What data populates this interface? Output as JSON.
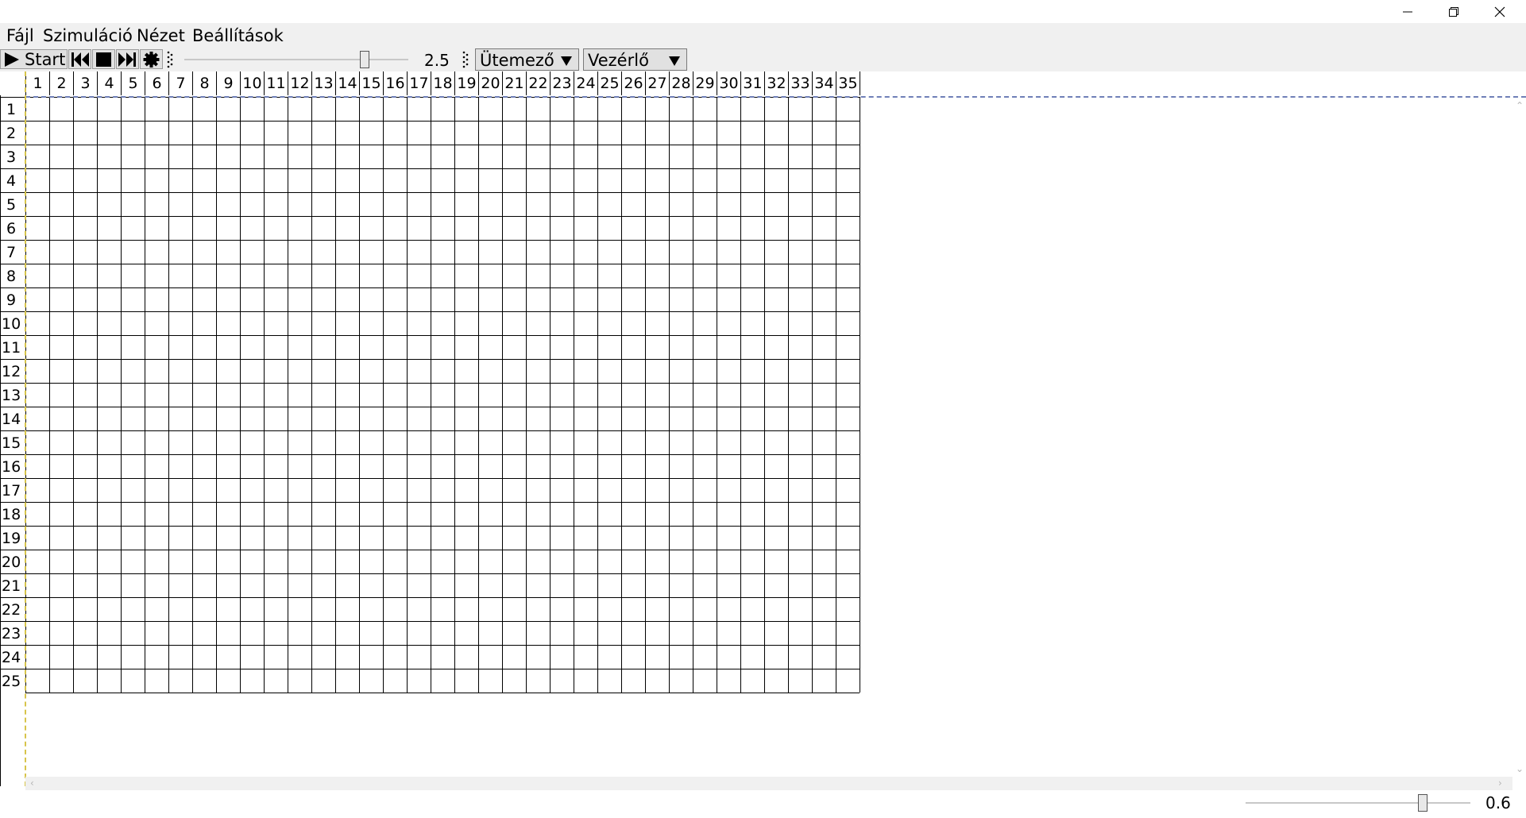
{
  "window": {
    "minimize_icon": "minimize-icon",
    "restore_icon": "restore-icon",
    "close_icon": "close-icon"
  },
  "menu": {
    "items": [
      "Fájl",
      "Szimuláció",
      "Nézet",
      "Beállítások"
    ]
  },
  "toolbar": {
    "start_label": "Start",
    "icons": [
      "play-icon",
      "rewind-icon",
      "stop-icon",
      "fast-forward-icon",
      "gear-icon"
    ],
    "speed_value": "2.5",
    "speed_slider_fraction": 0.82,
    "scheduler_combo": "Ütemező",
    "controller_combo": "Vezérlő"
  },
  "grid": {
    "columns": [
      "1",
      "2",
      "3",
      "4",
      "5",
      "6",
      "7",
      "8",
      "9",
      "10",
      "11",
      "12",
      "13",
      "14",
      "15",
      "16",
      "17",
      "18",
      "19",
      "20",
      "21",
      "22",
      "23",
      "24",
      "25",
      "26",
      "27",
      "28",
      "29",
      "30",
      "31",
      "32",
      "33",
      "34",
      "35"
    ],
    "rows": [
      "1",
      "2",
      "3",
      "4",
      "5",
      "6",
      "7",
      "8",
      "9",
      "10",
      "11",
      "12",
      "13",
      "14",
      "15",
      "16",
      "17",
      "18",
      "19",
      "20",
      "21",
      "22",
      "23",
      "24",
      "25"
    ]
  },
  "status": {
    "zoom_value": "0.6",
    "zoom_slider_fraction": 0.8
  }
}
